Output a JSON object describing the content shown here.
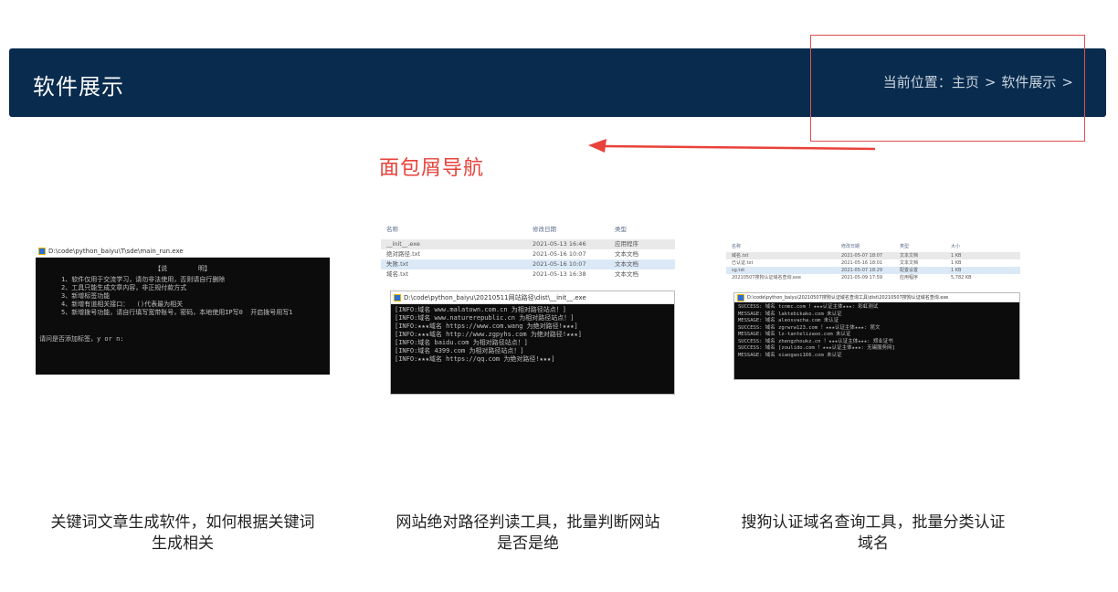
{
  "header": {
    "title": "软件展示",
    "breadcrumb": {
      "prefix": "当前位置：",
      "items": [
        "主页",
        "软件展示"
      ],
      "separator": ">"
    }
  },
  "annotation": {
    "label": "面包屑导航",
    "color": "#e8423a"
  },
  "cards": [
    {
      "title_line1": "关键词文章生成软件，如何根据关键词",
      "title_line2": "生成相关",
      "shot": {
        "window_title": "D:\\code\\python_baiyu\\T\\sde\\main_run.exe",
        "console_heading": "【说        明】",
        "console_lines": [
          "1、软件仅用于交流学习，请勿非法使用，否则请自行删除",
          "2、工具只能生成文章内容，非正规付款方式",
          "3、新增标签功能",
          "4、新增有道相关接口：  ()代表最为相关",
          "5、新增拨号功能，请自行填写宽带账号，密码，本地使用IP写0  开启拨号用写1"
        ],
        "prompt": "请问是否添加标签，y or n:"
      }
    },
    {
      "title_line1": "网站绝对路径判读工具，批量判断网站",
      "title_line2": "是否是绝",
      "shot": {
        "columns": [
          "名称",
          "修改日期",
          "类型"
        ],
        "files": [
          {
            "name": "__init__.exe",
            "date": "2021-05-13 16:46",
            "type": "应用程序"
          },
          {
            "name": "绝对路径.txt",
            "date": "2021-05-16 10:07",
            "type": "文本文档"
          },
          {
            "name": "失败.txt",
            "date": "2021-05-16 10:07",
            "type": "文本文档"
          },
          {
            "name": "域名.txt",
            "date": "2021-05-13 16:38",
            "type": "文本文档"
          }
        ],
        "window_title": "D:\\code\\python_baiyu\\20210511网站路径\\dist\\__init__.exe",
        "console_lines": [
          "[INFO:域名 www.malatown.com.cn 为相对路径站点！]",
          "[INFO:域名 www.naturerepublic.cn 为相对路径站点！]",
          "[INFO:★★★域名 https://www.com.wang 为绝对路径!★★★]",
          "[INFO:★★★域名 http://www.zgpyhs.com 为绝对路径!★★★]",
          "[INFO:域名 baidu.com 为相对路径站点！]",
          "[INFO:域名 4399.com 为相对路径站点！]",
          "[INFO:★★★域名 https://qq.com 为绝对路径!★★★]"
        ]
      }
    },
    {
      "title_line1": "搜狗认证域名查询工具，批量分类认证",
      "title_line2": "域名",
      "shot": {
        "columns": [
          "名称",
          "修改日期",
          "类型",
          "大小"
        ],
        "files": [
          {
            "name": "域名.txt",
            "date": "2021-05-07 18:07",
            "type": "文本文档",
            "size": "1 KB"
          },
          {
            "name": "已认证.txt",
            "date": "2021-05-16 18:01",
            "type": "文本文档",
            "size": "1 KB"
          },
          {
            "name": "sg.txt",
            "date": "2021-05-07 18:29",
            "type": "配置设置",
            "size": "1 KB"
          },
          {
            "name": "20210507搜狗认证域名查询.exe",
            "date": "2021-05-09 17:59",
            "type": "应用程序",
            "size": "5,782 KB"
          }
        ],
        "window_title": "D:\\code\\python_baiyu\\20210507搜狗认证域名查询工具\\dist\\20210507搜狗认证域名查询.exe",
        "console_lines": [
          "SUCCESS: 域名 tcnmc.com ！★★★认证主体★★★: 彩虹测试",
          "MESSAGE: 域名 laktebikako.com 未认证",
          "MESSAGE: 域名 aleosvacha.com 未认证",
          "SUCCESS: 域名 zgrwrw123.com ！★★★认证主体★★★: 昆文",
          "MESSAGE: 域名 lz-tantelizaoo.com 未认证",
          "SUCCESS: 域名 zhengzhoukz.cn ！★★★认证主体★★★: 郑业证书",
          "SUCCESS: 域名 [zoulido.com ！★★★认证主体★★★: 无锡服务网]",
          "MESSAGE: 域名 xiaogaoi166.com 未认证"
        ]
      }
    }
  ]
}
